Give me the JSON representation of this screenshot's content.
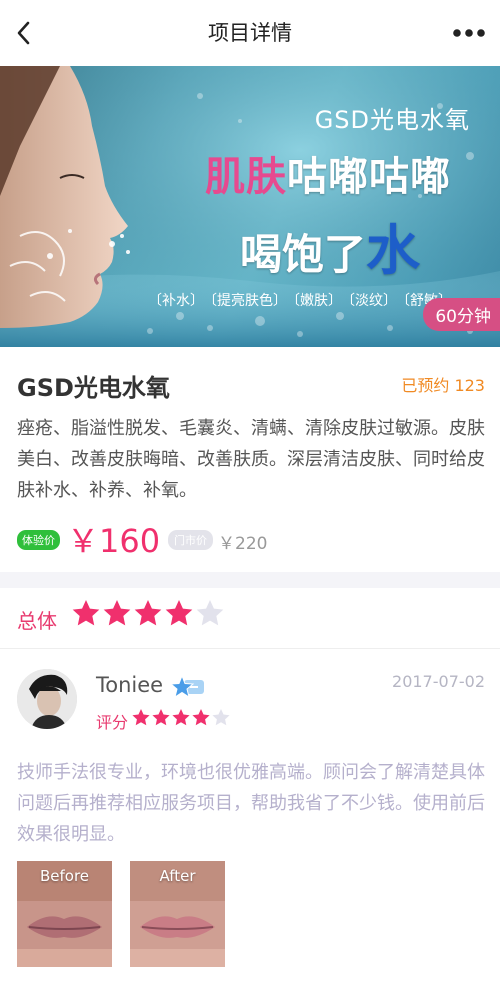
{
  "nav": {
    "title": "项目详情",
    "back_icon": "chevron-left-icon",
    "more_icon": "more-dots-icon"
  },
  "banner": {
    "product": "GSD光电水氧",
    "line1_a": "肌肤",
    "line1_b": "咕嘟咕嘟",
    "line2_a": "喝",
    "line2_b": "饱了",
    "line2_c": "水",
    "tags": [
      "〔补水〕",
      "〔提亮肤色〕",
      "〔嫩肤〕",
      "〔淡纹〕",
      "〔舒敏〕"
    ],
    "duration": "60分钟"
  },
  "product": {
    "name": "GSD光电水氧",
    "booked": "已预约 123",
    "description": "痤疮、脂溢性脱发、毛囊炎、清螨、清除皮肤过敏源。皮肤美白、改善皮肤晦暗、改善肤质。深层清洁皮肤、同时给皮肤补水、补养、补氧。",
    "exp_tag": "体验价",
    "price": "￥160",
    "market_tag": "门市价",
    "market_price": "￥220"
  },
  "rating": {
    "label": "总体",
    "stars": 4,
    "max": 5
  },
  "review": {
    "user": "Toniee",
    "date": "2017-07-02",
    "score_label": "评分",
    "score": 4,
    "max": 5,
    "text": "技师手法很专业，环境也很优雅高端。顾问会了解清楚具体问题后再推荐相应服务项目，帮助我省了不少钱。使用前后效果很明显。",
    "photos": [
      {
        "label": "Before"
      },
      {
        "label": "After"
      }
    ]
  },
  "colors": {
    "accent": "#f0306d",
    "star_active": "#f0306d",
    "star_inactive": "#e2e2ec",
    "booked": "#f08a24",
    "exp_tag": "#2fbf3b"
  }
}
